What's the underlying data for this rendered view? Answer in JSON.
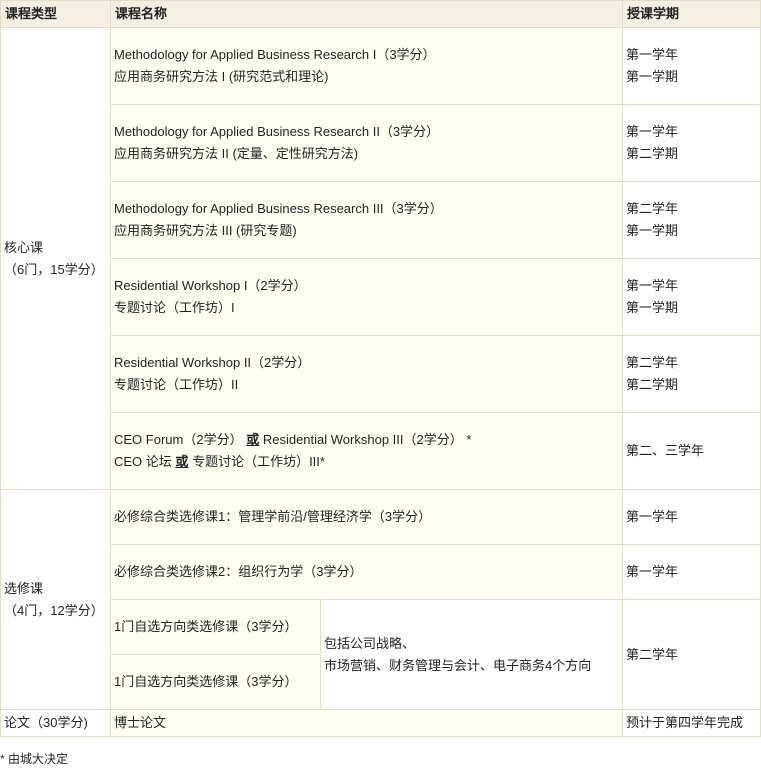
{
  "headers": {
    "type": "课程类型",
    "name": "课程名称",
    "term": "授课学期"
  },
  "groups": {
    "core": {
      "line1": "核心课",
      "line2": "（6门，15学分）"
    },
    "elective": {
      "line1": "选修课",
      "line2": "（4门，12学分）"
    },
    "thesis": {
      "label": "论文（30学分)"
    }
  },
  "core_courses": [
    {
      "en": "Methodology for Applied Business Research I（3学分）",
      "zh": "应用商务研究方法 I (研究范式和理论)",
      "term1": "第一学年",
      "term2": "第一学期"
    },
    {
      "en": "Methodology for Applied Business Research II（3学分）",
      "zh": "应用商务研究方法 II (定量、定性研究方法)",
      "term1": "第一学年",
      "term2": "第二学期"
    },
    {
      "en": "Methodology for Applied Business Research III（3学分）",
      "zh": "应用商务研究方法 III (研究专题)",
      "term1": "第二学年",
      "term2": "第一学期"
    },
    {
      "en": "Residential Workshop I（2学分）",
      "zh": "专题讨论（工作坊）I",
      "term1": "第一学年",
      "term2": "第一学期"
    },
    {
      "en": "Residential Workshop II（2学分）",
      "zh": "专题讨论（工作坊）II",
      "term1": "第二学年",
      "term2": "第二学期"
    }
  ],
  "ceo_course": {
    "line1_a": "CEO Forum（2学分）",
    "line1_or": "或",
    "line1_b": "Residential Workshop III（2学分） *",
    "line2_a": "CEO 论坛",
    "line2_or": "或",
    "line2_b": "专题讨论（工作坊）III*",
    "term": "第二、三学年"
  },
  "elective_courses": [
    {
      "name": "必修综合类选修课1：管理学前沿/管理经济学（3学分）",
      "term": "第一学年"
    },
    {
      "name": "必修综合类选修课2：组织行为学（3学分）",
      "term": "第一学年"
    }
  ],
  "direction_electives": {
    "items": [
      "1门自选方向类选修课（3学分）",
      "1门自选方向类选修课（3学分）"
    ],
    "note_line1": "包括公司战略、",
    "note_line2": "市场营销、财务管理与会计、电子商务4个方向",
    "term": "第二学年"
  },
  "thesis_course": {
    "name": "博士论文",
    "term": "预计于第四学年完成"
  },
  "footnote": "* 由城大决定"
}
